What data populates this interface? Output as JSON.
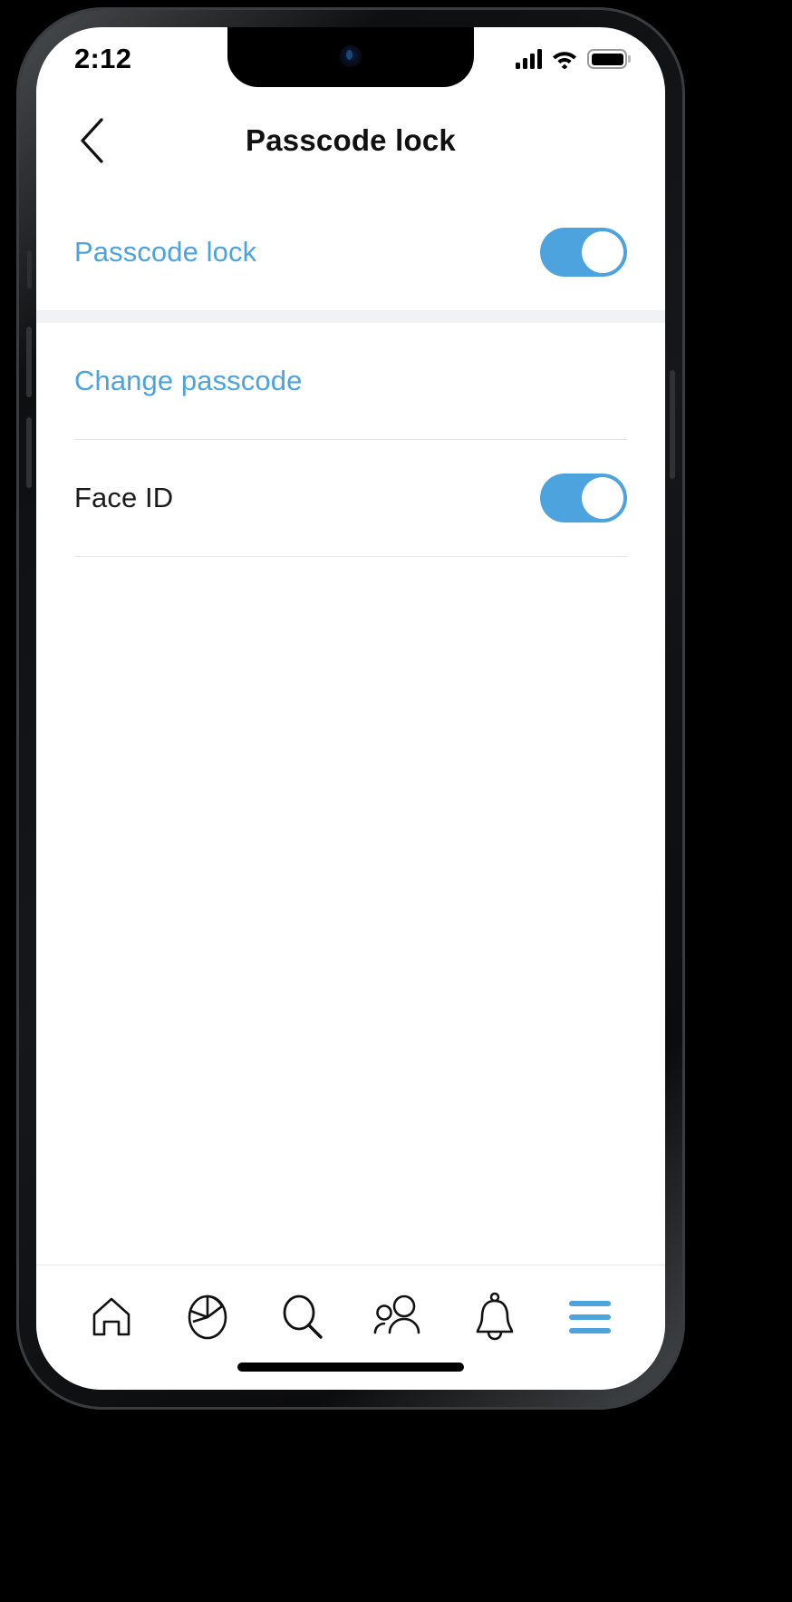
{
  "status_bar": {
    "time": "2:12",
    "signal_icon": "cellular-signal-icon",
    "signal_bars": 4,
    "wifi_icon": "wifi-icon",
    "battery_icon": "battery-full-icon",
    "battery_level": "full"
  },
  "header": {
    "back_icon": "chevron-left-icon",
    "title": "Passcode lock"
  },
  "colors": {
    "accent": "#4da3dd",
    "text": "#1b1b1b",
    "divider": "#e4e6e8",
    "group_gap": "#f1f2f3",
    "screen_bg": "#ffffff",
    "frame": "#1b1d1f"
  },
  "sections": [
    {
      "name": "passcode-lock-section",
      "rows": [
        {
          "name": "passcode-lock",
          "label": "Passcode lock",
          "style": "accent",
          "control": "toggle",
          "toggle_state": "on"
        }
      ]
    },
    {
      "name": "passcode-options-section",
      "rows": [
        {
          "name": "change-passcode",
          "label": "Change passcode",
          "style": "accent",
          "control": "none",
          "toggle_state": ""
        },
        {
          "name": "face-id",
          "label": "Face ID",
          "style": "plain",
          "control": "toggle",
          "toggle_state": "on"
        }
      ]
    }
  ],
  "tab_bar": {
    "items": [
      {
        "name": "tab-home",
        "icon": "home-icon",
        "active": false
      },
      {
        "name": "tab-dashboard",
        "icon": "pie-chart-icon",
        "active": false
      },
      {
        "name": "tab-search",
        "icon": "search-icon",
        "active": false
      },
      {
        "name": "tab-contacts",
        "icon": "people-icon",
        "active": false
      },
      {
        "name": "tab-notifications",
        "icon": "bell-icon",
        "active": false
      },
      {
        "name": "tab-menu",
        "icon": "hamburger-menu-icon",
        "active": true
      }
    ]
  },
  "home_indicator": {
    "name": "home-indicator"
  }
}
